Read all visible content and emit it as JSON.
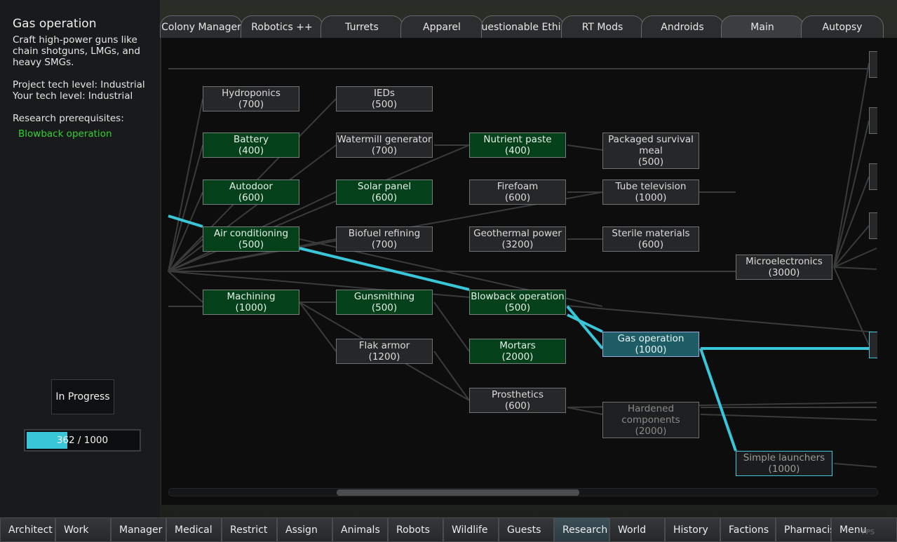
{
  "project": {
    "title": "Gas operation",
    "description": "Craft high-power guns like chain shotguns, LMGs, and heavy SMGs.",
    "project_tech": "Project tech level: Industrial",
    "your_tech": "Your tech level: Industrial",
    "prereq_header": "Research prerequisites:",
    "prereq_item": "Blowback operation",
    "status_button": "In Progress",
    "progress_text": "362 / 1000",
    "progress_fraction": 0.362
  },
  "tabs": [
    "Colony Manager",
    "Robotics ++",
    "Turrets",
    "Apparel",
    "Questionable Ethics",
    "RT Mods",
    "Androids",
    "Main",
    "Autopsy"
  ],
  "active_tab": "Main",
  "nodes": [
    {
      "id": "hydroponics",
      "label": "Hydroponics",
      "cost": "(700)",
      "state": "open"
    },
    {
      "id": "battery",
      "label": "Battery",
      "cost": "(400)",
      "state": "done"
    },
    {
      "id": "autodoor",
      "label": "Autodoor",
      "cost": "(600)",
      "state": "done"
    },
    {
      "id": "aircon",
      "label": "Air conditioning",
      "cost": "(500)",
      "state": "done"
    },
    {
      "id": "machining",
      "label": "Machining",
      "cost": "(1000)",
      "state": "done"
    },
    {
      "id": "ieds",
      "label": "IEDs",
      "cost": "(500)",
      "state": "open"
    },
    {
      "id": "watermill",
      "label": "Watermill generator",
      "cost": "(700)",
      "state": "open"
    },
    {
      "id": "solar",
      "label": "Solar panel",
      "cost": "(600)",
      "state": "done"
    },
    {
      "id": "biofuel",
      "label": "Biofuel refining",
      "cost": "(700)",
      "state": "open"
    },
    {
      "id": "gunsmithing",
      "label": "Gunsmithing",
      "cost": "(500)",
      "state": "done"
    },
    {
      "id": "flak",
      "label": "Flak armor",
      "cost": "(1200)",
      "state": "open"
    },
    {
      "id": "nutrient",
      "label": "Nutrient paste",
      "cost": "(400)",
      "state": "done"
    },
    {
      "id": "firefoam",
      "label": "Firefoam",
      "cost": "(600)",
      "state": "open"
    },
    {
      "id": "geothermal",
      "label": "Geothermal power",
      "cost": "(3200)",
      "state": "open"
    },
    {
      "id": "blowback",
      "label": "Blowback operation",
      "cost": "(500)",
      "state": "done"
    },
    {
      "id": "mortars",
      "label": "Mortars",
      "cost": "(2000)",
      "state": "done"
    },
    {
      "id": "prosthetics",
      "label": "Prosthetics",
      "cost": "(600)",
      "state": "open"
    },
    {
      "id": "packaged",
      "label": "Packaged survival meal",
      "cost": "(500)",
      "state": "open"
    },
    {
      "id": "tubetv",
      "label": "Tube television",
      "cost": "(1000)",
      "state": "open"
    },
    {
      "id": "sterile",
      "label": "Sterile materials",
      "cost": "(600)",
      "state": "open"
    },
    {
      "id": "gasop",
      "label": "Gas operation",
      "cost": "(1000)",
      "state": "selected"
    },
    {
      "id": "hardened",
      "label": "Hardened components",
      "cost": "(2000)",
      "state": "locked"
    },
    {
      "id": "microelec",
      "label": "Microelectronics",
      "cost": "(3000)",
      "state": "open"
    },
    {
      "id": "simplelaunch",
      "label": "Simple launchers",
      "cost": "(1000)",
      "state": "target"
    }
  ],
  "bottom_tabs": [
    "Architect",
    "Work",
    "Manager",
    "Medical",
    "Restrict",
    "Assign",
    "Animals",
    "Robots",
    "Wildlife",
    "Guests",
    "Research",
    "World",
    "History",
    "Factions",
    "Pharmacist",
    "Menu"
  ],
  "active_bottom_tab": "Research",
  "colors": {
    "accent": "#38c6d8",
    "done": "#04401a",
    "selected": "#1f5d66",
    "prereq": "#35d035"
  }
}
